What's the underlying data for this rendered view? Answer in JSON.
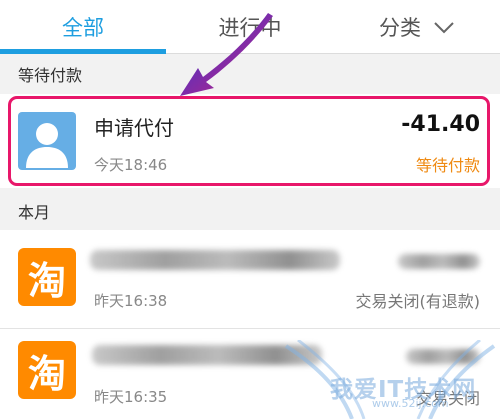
{
  "tabs": [
    {
      "label": "全部",
      "active": true
    },
    {
      "label": "进行中",
      "active": false
    },
    {
      "label": "分类",
      "active": false
    }
  ],
  "colors": {
    "accent": "#1e9ee0",
    "highlight": "#e8176a",
    "pending": "#ef8a12",
    "avatar_bg": "#66aee5",
    "taobao_bg": "#ff8a00"
  },
  "sections": {
    "pending": {
      "title": "等待付款",
      "items": [
        {
          "title": "申请代付",
          "time": "今天18:46",
          "amount": "-41.40",
          "status": "等待付款",
          "icon": "user-avatar-icon"
        }
      ]
    },
    "this_month": {
      "title": "本月",
      "items": [
        {
          "time": "昨天16:38",
          "status": "交易关闭(有退款)",
          "icon": "taobao-icon",
          "icon_glyph": "淘"
        },
        {
          "time": "昨天16:35",
          "status": "交易关闭",
          "icon": "taobao-icon",
          "icon_glyph": "淘"
        }
      ]
    }
  },
  "watermark": {
    "text": "我爱IT技术网",
    "sub": "www.52ij.com"
  }
}
